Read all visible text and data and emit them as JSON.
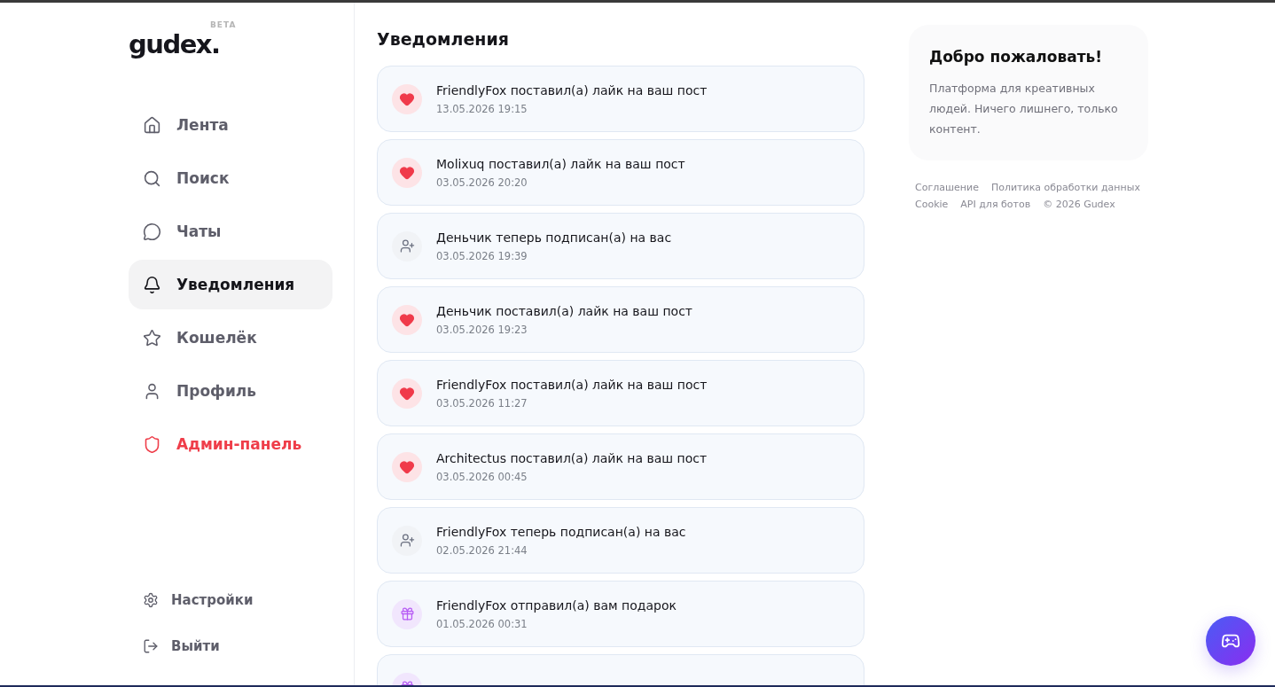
{
  "logo": {
    "name": "gudex.",
    "badge": "BETA"
  },
  "nav": [
    {
      "label": "Лента",
      "selected": false,
      "kind": "link"
    },
    {
      "label": "Поиск",
      "selected": false,
      "kind": "link"
    },
    {
      "label": "Чаты",
      "selected": false,
      "kind": "link"
    },
    {
      "label": "Уведомления",
      "selected": true,
      "kind": "link"
    },
    {
      "label": "Кошелёк",
      "selected": false,
      "kind": "link"
    },
    {
      "label": "Профиль",
      "selected": false,
      "kind": "link"
    },
    {
      "label": "Админ-панель",
      "selected": false,
      "kind": "admin"
    }
  ],
  "bottom_nav": [
    {
      "label": "Настройки"
    },
    {
      "label": "Выйти"
    }
  ],
  "page_title": "Уведомления",
  "notifications": [
    {
      "kind": "like",
      "text": "FriendlyFox поставил(а) лайк на ваш пост",
      "time": "13.05.2026 19:15"
    },
    {
      "kind": "like",
      "text": "Molixuq поставил(а) лайк на ваш пост",
      "time": "03.05.2026 20:20"
    },
    {
      "kind": "follow",
      "text": "Деньчик теперь подписан(а) на вас",
      "time": "03.05.2026 19:39"
    },
    {
      "kind": "like",
      "text": "Деньчик поставил(а) лайк на ваш пост",
      "time": "03.05.2026 19:23"
    },
    {
      "kind": "like",
      "text": "FriendlyFox поставил(а) лайк на ваш пост",
      "time": "03.05.2026 11:27"
    },
    {
      "kind": "like",
      "text": "Architectus поставил(а) лайк на ваш пост",
      "time": "03.05.2026 00:45"
    },
    {
      "kind": "follow",
      "text": "FriendlyFox теперь подписан(а) на вас",
      "time": "02.05.2026 21:44"
    },
    {
      "kind": "gift",
      "text": "FriendlyFox отправил(а) вам подарок",
      "time": "01.05.2026 00:31"
    },
    {
      "kind": "gift"
    }
  ],
  "welcome": {
    "title": "Добро пожаловать!",
    "text": "Платформа для креативных людей. Ничего лишнего, только контент."
  },
  "footer_links": [
    "Соглашение",
    "Политика обработки данных",
    "Cookie",
    "API для ботов",
    "© 2026 Gudex"
  ]
}
